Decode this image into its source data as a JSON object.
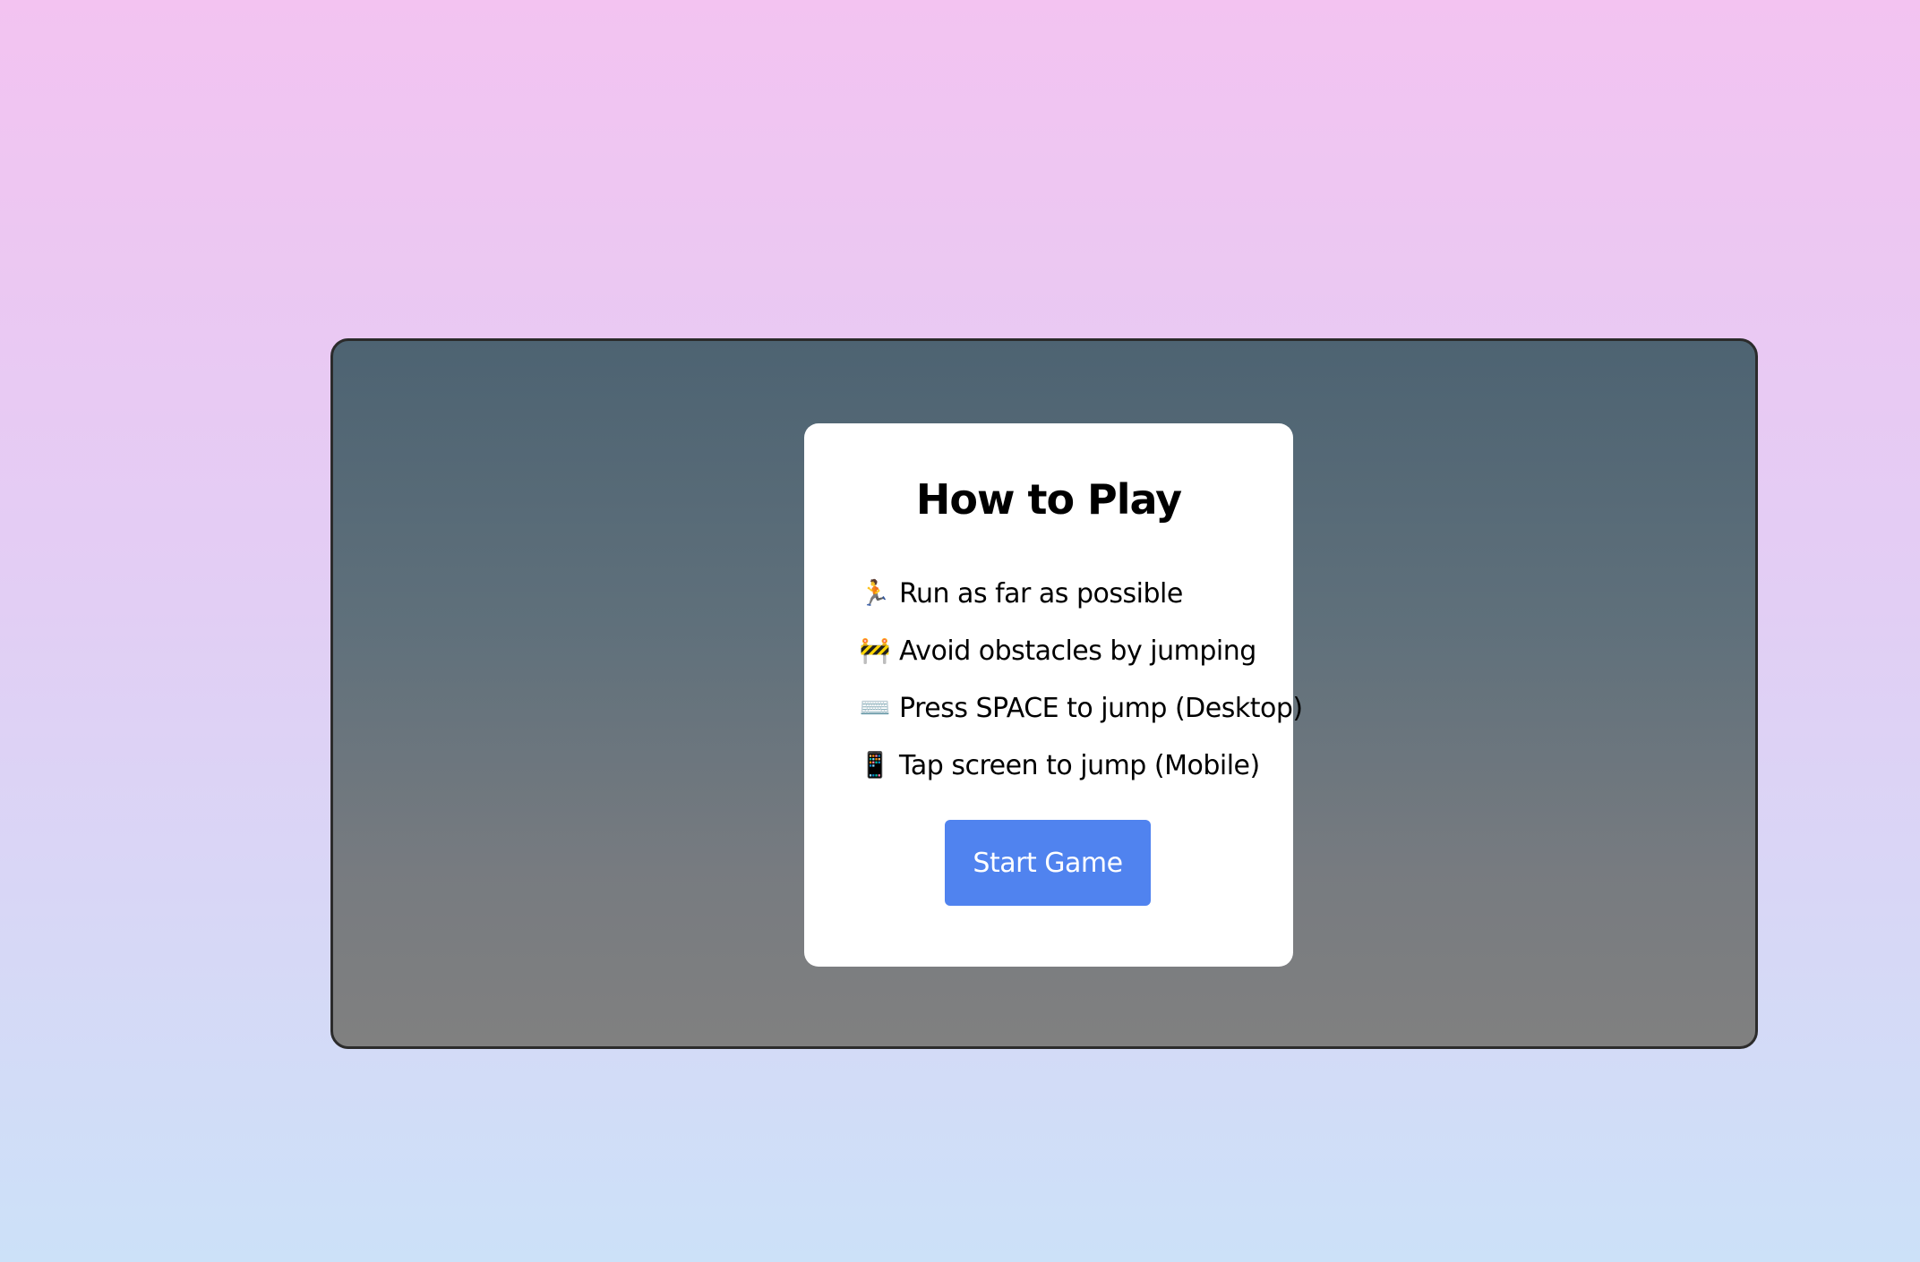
{
  "instructions": {
    "title": "How to Play",
    "rules": [
      {
        "icon": "running-person-icon",
        "glyph": "🏃",
        "text": "Run as far as possible"
      },
      {
        "icon": "construction-barrier-icon",
        "glyph": "🚧",
        "text": "Avoid obstacles by jumping"
      },
      {
        "icon": "keyboard-icon",
        "glyph": "⌨️",
        "text": "Press SPACE to jump (Desktop)"
      },
      {
        "icon": "mobile-phone-icon",
        "glyph": "📱",
        "text": "Tap screen to jump (Mobile)"
      }
    ],
    "start_button_label": "Start Game"
  },
  "colors": {
    "button": "#5083ef",
    "card": "#ffffff",
    "frame_top": "#4d6372",
    "frame_bottom": "#808080"
  }
}
